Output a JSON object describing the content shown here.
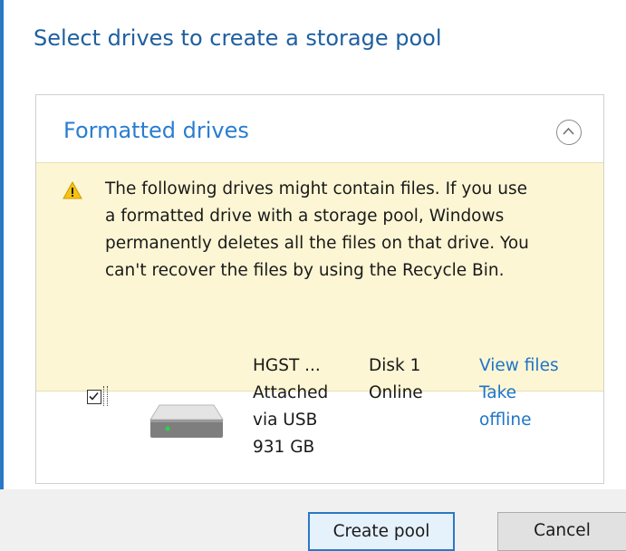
{
  "dialog": {
    "title": "Select drives to create a storage pool"
  },
  "section": {
    "title": "Formatted drives",
    "collapse_icon": "chevron-up-circle-icon"
  },
  "warning": {
    "icon": "warning-triangle-icon",
    "lines": [
      "The following drives might contain files. If you use",
      "a formatted drive with a storage pool, Windows",
      "permanently deletes all the files on that drive. You",
      "can't recover the files by using the Recycle Bin."
    ]
  },
  "drive": {
    "checked": true,
    "icon": "hard-drive-icon",
    "name_lines": [
      "HGST ...",
      "Attached",
      "via USB",
      "931 GB"
    ],
    "disk_lines": [
      "Disk 1",
      "Online"
    ],
    "view_files_label": "View files",
    "take_offline_lines": [
      "Take",
      "offline"
    ]
  },
  "buttons": {
    "create_label": "Create pool",
    "cancel_label": "Cancel"
  },
  "colors": {
    "accent": "#2a7dd0",
    "title": "#1f5fa0",
    "warning_bg": "#fcf6d4",
    "link": "#1e74c8"
  }
}
